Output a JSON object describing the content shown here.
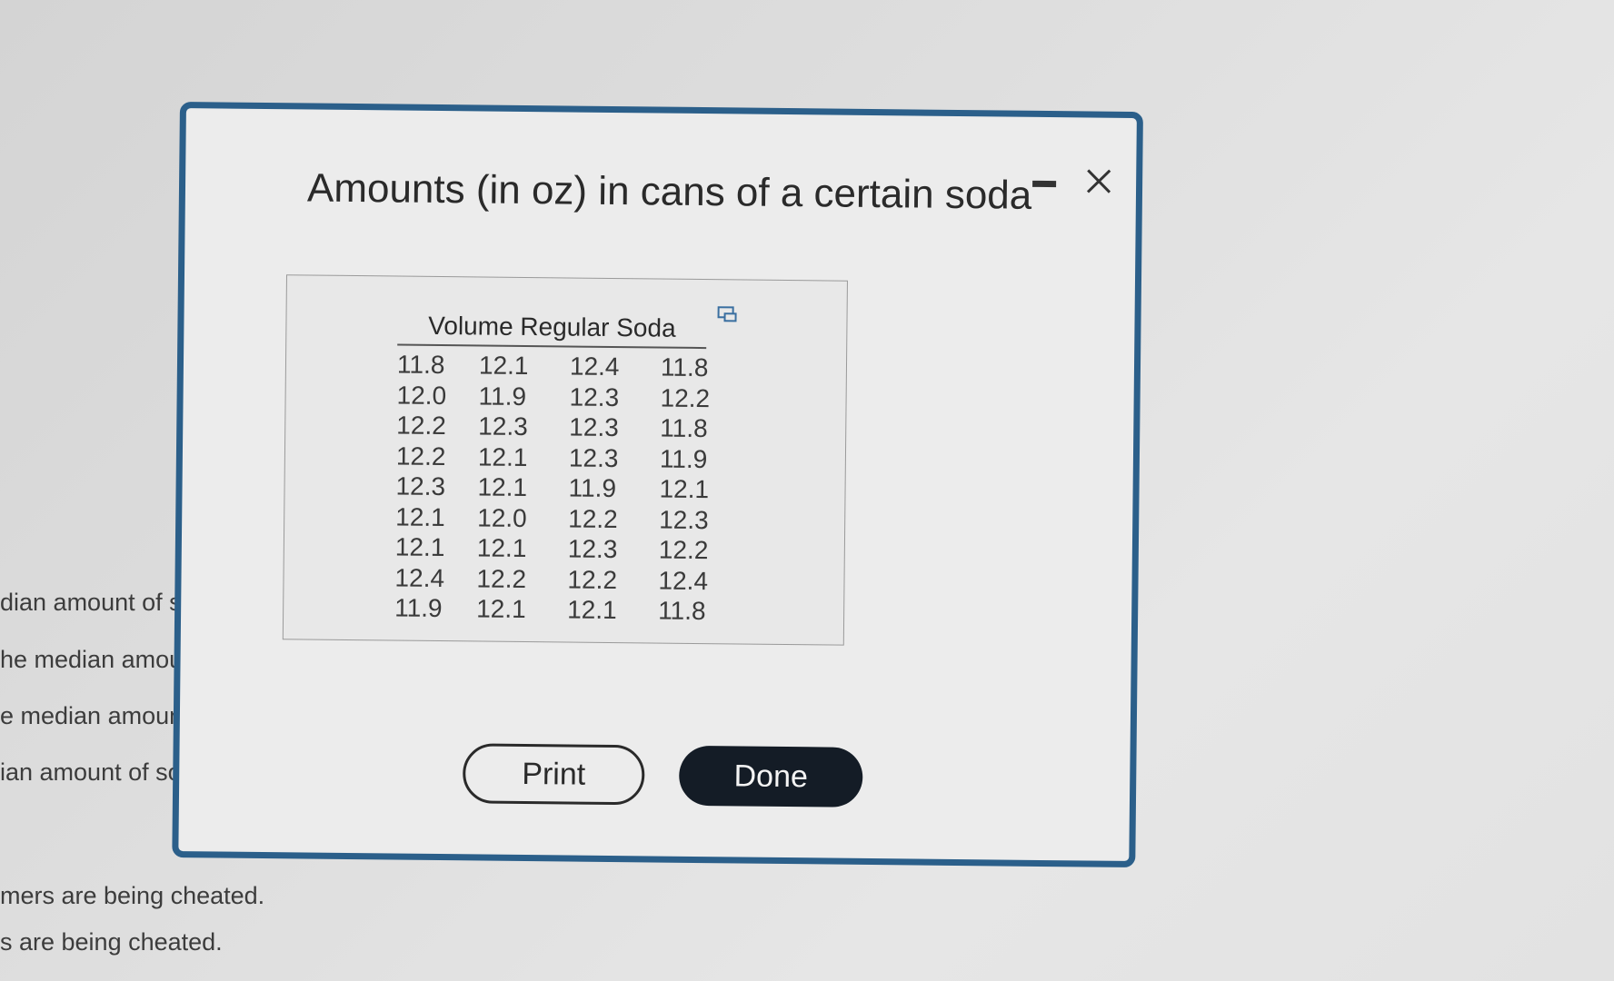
{
  "background_text": [
    "dian amount of s",
    "he median amou",
    "e median amoun",
    "ian amount of so",
    "mers are being cheated.",
    "s are being cheated."
  ],
  "dialog": {
    "title": "Amounts (in oz) in cans of a certain soda",
    "table_header": "Volume Regular Soda",
    "table_rows": [
      [
        "11.8",
        "12.1",
        "12.4",
        "11.8"
      ],
      [
        "12.0",
        "11.9",
        "12.3",
        "12.2"
      ],
      [
        "12.2",
        "12.3",
        "12.3",
        "11.8"
      ],
      [
        "12.2",
        "12.1",
        "12.3",
        "11.9"
      ],
      [
        "12.3",
        "12.1",
        "11.9",
        "12.1"
      ],
      [
        "12.1",
        "12.0",
        "12.2",
        "12.3"
      ],
      [
        "12.1",
        "12.1",
        "12.3",
        "12.2"
      ],
      [
        "12.4",
        "12.2",
        "12.2",
        "12.4"
      ],
      [
        "11.9",
        "12.1",
        "12.1",
        "11.8"
      ]
    ],
    "print_label": "Print",
    "done_label": "Done"
  },
  "colors": {
    "dialog_border": "#2b5f8a",
    "done_button": "#141c26"
  }
}
